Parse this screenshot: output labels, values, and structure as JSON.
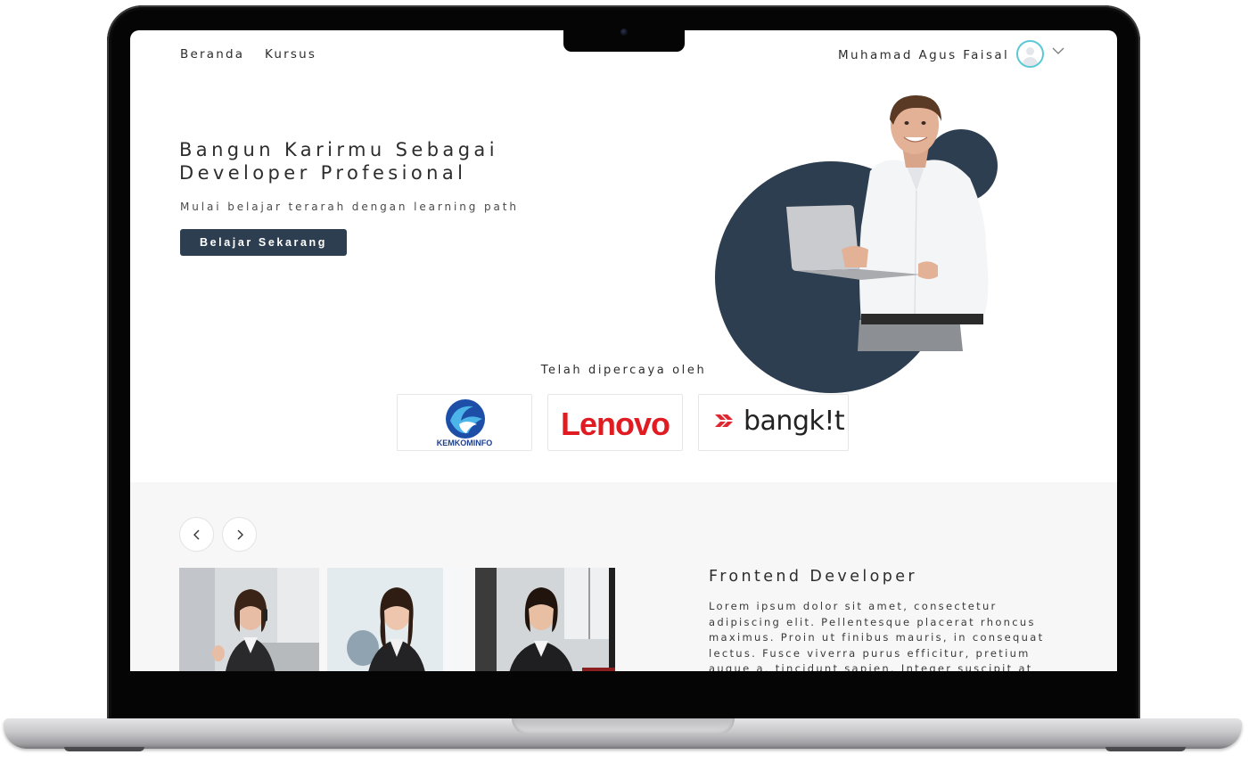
{
  "nav": {
    "links": [
      "Beranda",
      "Kursus"
    ],
    "user_name": "Muhamad Agus Faisal"
  },
  "hero": {
    "title": "Bangun Karirmu Sebagai Developer Profesional",
    "subtitle": "Mulai belajar terarah dengan learning path",
    "cta": "Belajar Sekarang"
  },
  "trusted": {
    "label": "Telah dipercaya oleh",
    "logos": [
      "KEMKOMINFO",
      "Lenovo",
      "bangk!t"
    ]
  },
  "course": {
    "title": "Frontend Developer",
    "description": "Lorem ipsum dolor sit amet, consectetur adipiscing elit. Pellentesque placerat rhoncus maximus. Proin ut finibus mauris, in consequat lectus. Fusce viverra purus efficitur, pretium augue a, tincidunt sapien. Integer suscipit at"
  },
  "icons": {
    "avatar": "user-avatar-icon",
    "dropdown": "chevron-down-icon",
    "prev": "chevron-left-icon",
    "next": "chevron-right-icon"
  },
  "colors": {
    "primary": "#2e3e51",
    "accent": "#5bc8d6",
    "lenovo_red": "#e01b22",
    "section_bg": "#f7f7f7"
  }
}
